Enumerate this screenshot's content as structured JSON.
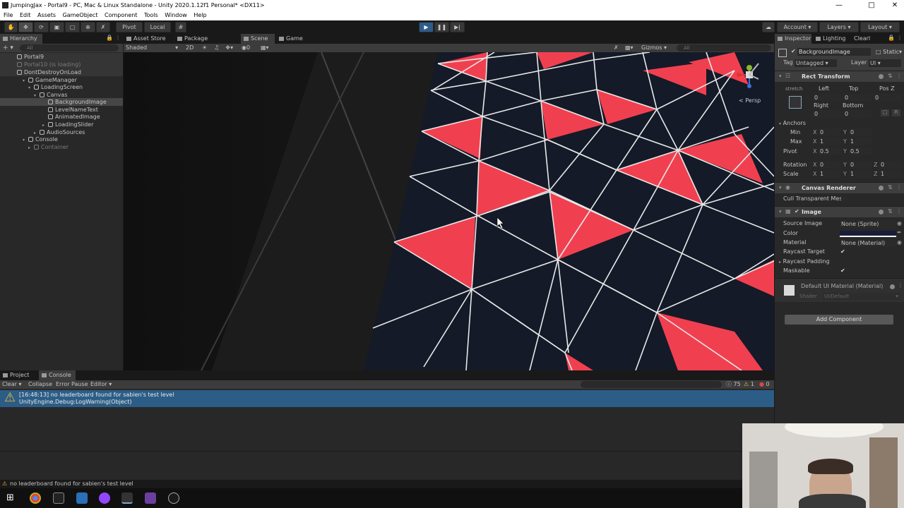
{
  "window": {
    "title": "JumpingJax - Portal9 - PC, Mac & Linux Standalone - Unity 2020.1.12f1 Personal* <DX11>"
  },
  "menu": [
    "File",
    "Edit",
    "Assets",
    "GameObject",
    "Component",
    "Tools",
    "Window",
    "Help"
  ],
  "toolbar": {
    "pivot": "Pivot",
    "local": "Local",
    "account": "Account",
    "layers": "Layers",
    "layout": "Layout"
  },
  "hierarchy": {
    "tab": "Hierarchy",
    "search_placeholder": "All",
    "rows": [
      {
        "label": "Portal9"
      },
      {
        "label": "Portal10 (is loading)"
      },
      {
        "label": "DontDestroyOnLoad"
      },
      {
        "label": "GameManager"
      },
      {
        "label": "LoadingScreen"
      },
      {
        "label": "Canvas"
      },
      {
        "label": "BackgroundImage"
      },
      {
        "label": "LevelNameText"
      },
      {
        "label": "AnimatedImage"
      },
      {
        "label": "LoadingSlider"
      },
      {
        "label": "AudioSources"
      },
      {
        "label": "Console"
      },
      {
        "label": "Container"
      }
    ]
  },
  "center_tabs": {
    "asset_store": "Asset Store",
    "package_manager": "Package Manager",
    "scene": "Scene",
    "game": "Game"
  },
  "scene_toolbar": {
    "shading": "Shaded",
    "mode": "2D",
    "hidden_count": "0",
    "gizmos": "Gizmos",
    "search_placeholder": "All",
    "persp": "< Persp"
  },
  "inspector": {
    "tab": "Inspector",
    "lighting_tab": "Lighting",
    "clear_tab": "Clearl",
    "object_name": "BackgroundImage",
    "static_label": "Static",
    "tag_label": "Tag",
    "tag_value": "Untagged",
    "layer_label": "Layer",
    "layer_value": "UI",
    "rect_transform": {
      "title": "Rect Transform",
      "stretch": "stretch",
      "left_label": "Left",
      "left": "0",
      "top_label": "Top",
      "top": "0",
      "posz_label": "Pos Z",
      "posz": "0",
      "right_label": "Right",
      "right": "0",
      "bottom_label": "Bottom",
      "bottom": "0",
      "anchors": "Anchors",
      "min_label": "Min",
      "min_x": "0",
      "min_y": "0",
      "max_label": "Max",
      "max_x": "1",
      "max_y": "1",
      "pivot_label": "Pivot",
      "pivot_x": "0.5",
      "pivot_y": "0.5",
      "rotation_label": "Rotation",
      "rot_x": "0",
      "rot_y": "0",
      "rot_z": "0",
      "scale_label": "Scale",
      "scale_x": "1",
      "scale_y": "1",
      "scale_z": "1"
    },
    "canvas_renderer": {
      "title": "Canvas Renderer",
      "cull": "Cull Transparent Mes"
    },
    "image": {
      "title": "Image",
      "source_image_label": "Source Image",
      "source_image": "None (Sprite)",
      "color_label": "Color",
      "material_label": "Material",
      "material": "None (Material)",
      "raycast_target_label": "Raycast Target",
      "raycast_padding_label": "Raycast Padding",
      "maskable_label": "Maskable"
    },
    "material_preview": {
      "title": "Default UI Material (Material)",
      "shader_label": "Shader",
      "shader": "UI/Default"
    },
    "add_component": "Add Component"
  },
  "console": {
    "project_tab": "Project",
    "console_tab": "Console",
    "clear": "Clear",
    "collapse": "Collapse",
    "error_pause": "Error Pause",
    "editor": "Editor",
    "log_count": "75",
    "warn_count": "1",
    "error_count": "0",
    "log_line1": "[16:48:13] no leaderboard found for sabien's test level",
    "log_line2": "UnityEngine.Debug:LogWarning(Object)"
  },
  "status": "no leaderboard found for sabien's test level",
  "colors": {
    "red_tile": "#f04050",
    "dark_tile": "#141a28",
    "selection": "#2c5d87"
  }
}
